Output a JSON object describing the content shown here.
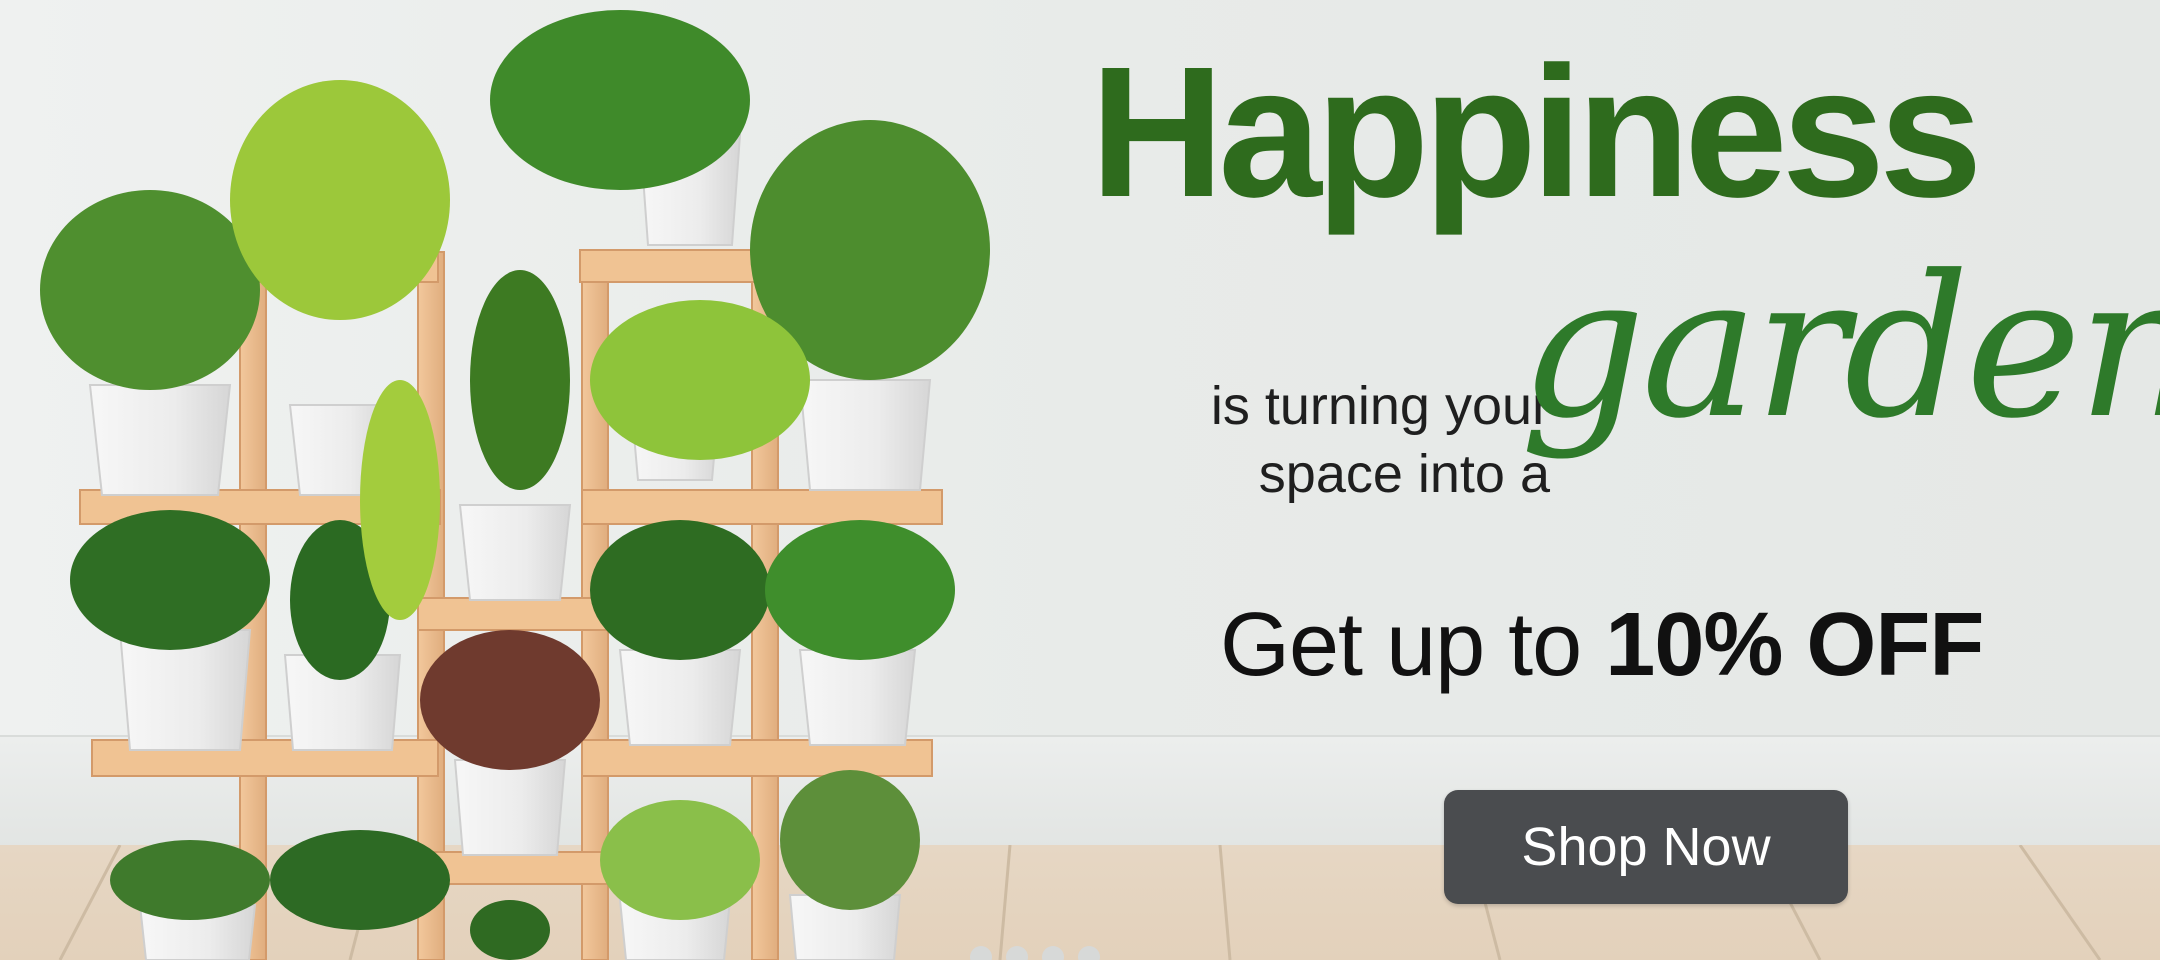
{
  "banner": {
    "headline": "Happiness",
    "sub_line_1": "is turning your",
    "sub_line_2": "space into a",
    "script_word": "garden...",
    "offer_prefix": "Get up to",
    "offer_strong": "10% OFF",
    "cta_label": "Shop Now"
  },
  "colors": {
    "headline": "#2e6b1d",
    "script": "#2e7a2a",
    "cta_bg": "#4a4c4f",
    "cta_text": "#ffffff"
  },
  "carousel": {
    "dot_count": 4
  }
}
